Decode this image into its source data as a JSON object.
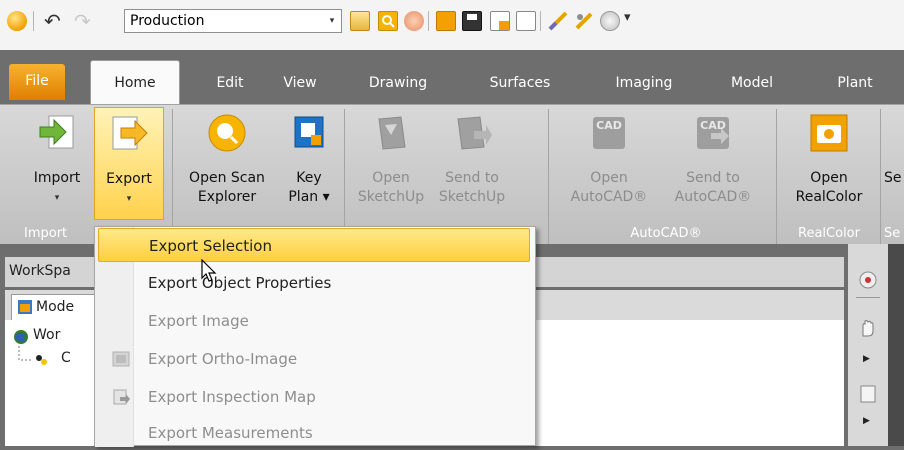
{
  "quick_access": {
    "project_combo": "Production",
    "combo_arrow": "▾",
    "undo_icon": "↶",
    "redo_icon": "↷"
  },
  "tabs": [
    {
      "label": "File"
    },
    {
      "label": "Home"
    },
    {
      "label": "Edit"
    },
    {
      "label": "View"
    },
    {
      "label": "Drawing"
    },
    {
      "label": "Surfaces"
    },
    {
      "label": "Imaging"
    },
    {
      "label": "Model"
    },
    {
      "label": "Plant"
    }
  ],
  "ribbon": {
    "import": {
      "line1": "Import",
      "dd": "▾"
    },
    "export": {
      "line1": "Export",
      "dd": "▾"
    },
    "open_scan": {
      "line1": "Open Scan",
      "line2": "Explorer"
    },
    "key_plan": {
      "line1": "Key",
      "line2": "Plan ▾"
    },
    "open_sketchup": {
      "line1": "Open",
      "line2": "SketchUp"
    },
    "send_sketchup": {
      "line1": "Send to",
      "line2": "SketchUp"
    },
    "open_autocad": {
      "line1": "Open",
      "line2": "AutoCAD®"
    },
    "send_autocad": {
      "line1": "Send to",
      "line2": "AutoCAD®"
    },
    "open_realcolor": {
      "line1": "Open",
      "line2": "RealColor"
    },
    "partial_right": {
      "line1": "Se"
    },
    "cad_icon_text": "CAD",
    "groups": {
      "import": "Import",
      "autocad": "AutoCAD®",
      "realcolor": "RealColor",
      "partial": "Se"
    }
  },
  "workspace": {
    "header": "WorkSpa",
    "tab": "Mode",
    "tree_root": "Wor",
    "tree_child": "C"
  },
  "export_menu": {
    "items": [
      {
        "label": "Export Selection",
        "state": "hover"
      },
      {
        "label": "Export Object Properties",
        "state": "enabled"
      },
      {
        "label": "Export Image",
        "state": "disabled"
      },
      {
        "label": "Export Ortho-Image",
        "state": "disabled"
      },
      {
        "label": "Export Inspection Map",
        "state": "disabled"
      },
      {
        "label": "Export Measurements",
        "state": "disabled"
      }
    ]
  },
  "colors": {
    "accent": "#f0a000",
    "hover": "#ffd24c",
    "tabbar": "#6e6e6e"
  }
}
